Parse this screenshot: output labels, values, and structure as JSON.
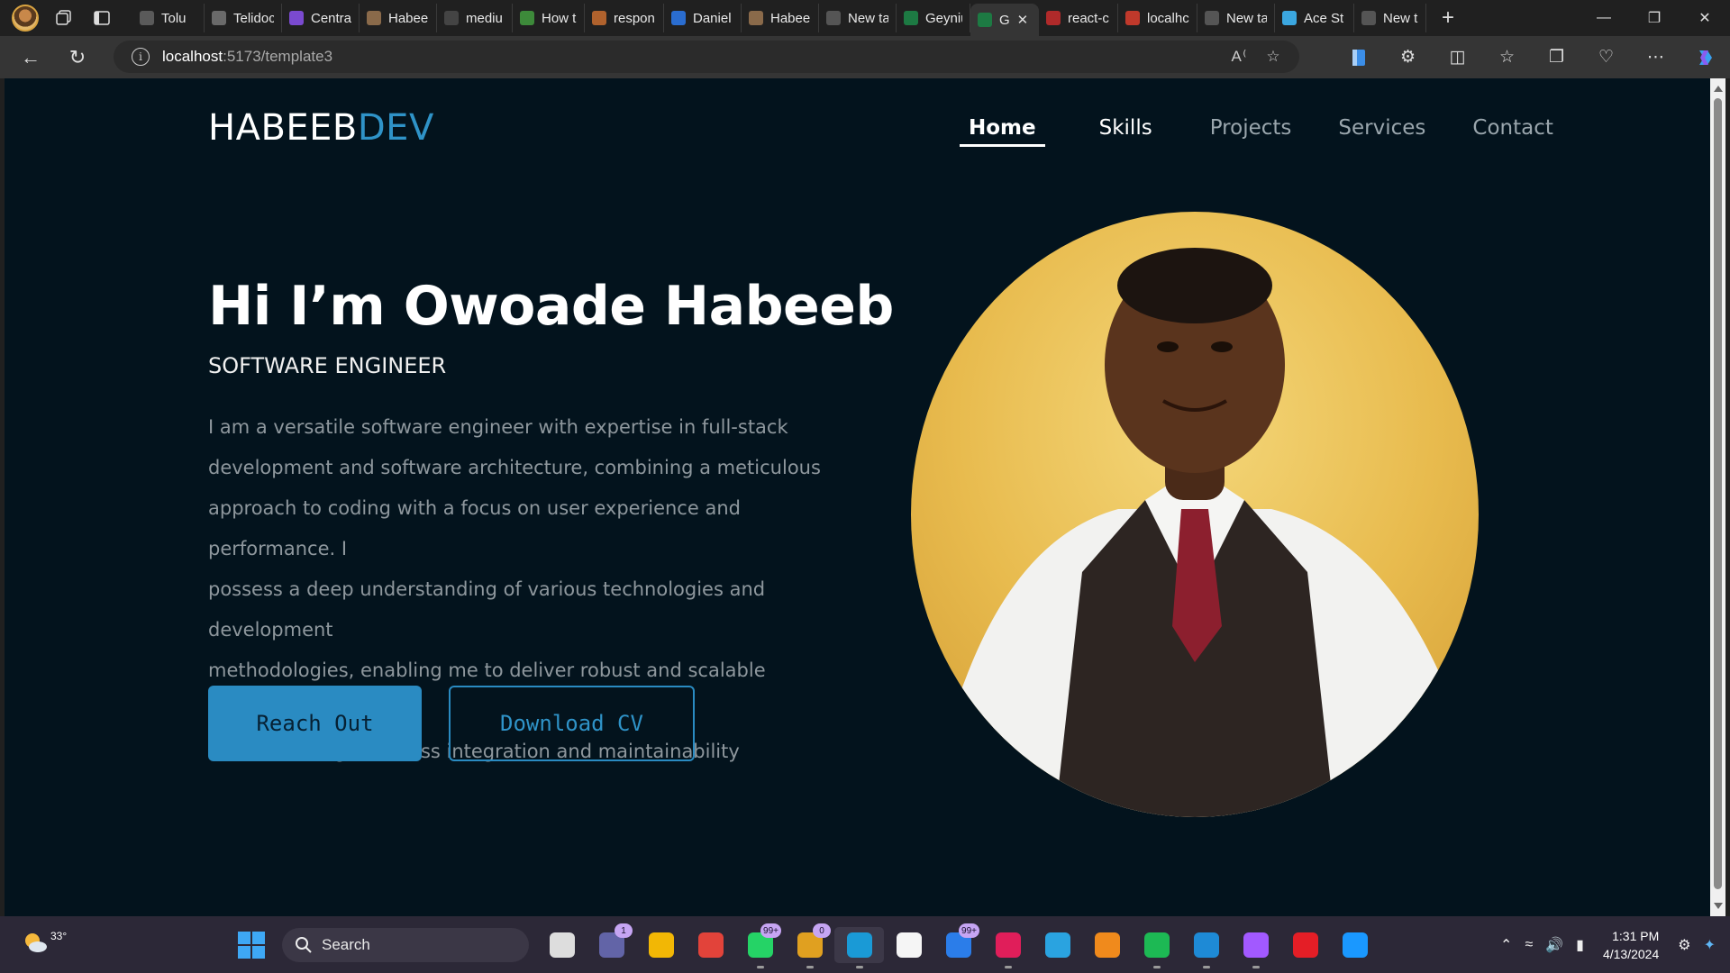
{
  "browser": {
    "tabs": [
      {
        "title": "Tolu",
        "color": "#5a5a5a"
      },
      {
        "title": "Telidoc",
        "color": "#6a6a6a"
      },
      {
        "title": "Centra",
        "color": "#7a4ad0"
      },
      {
        "title": "Habee",
        "color": "#8a6a4a"
      },
      {
        "title": "mediu",
        "color": "#444"
      },
      {
        "title": "How to",
        "color": "#3d8a3a"
      },
      {
        "title": "respon",
        "color": "#b0622d"
      },
      {
        "title": "Daniel",
        "color": "#2a6dd0"
      },
      {
        "title": "Habee",
        "color": "#8a6a4a"
      },
      {
        "title": "New ta",
        "color": "#555"
      },
      {
        "title": "Geyniu",
        "color": "#1d7a43"
      },
      {
        "title": "G",
        "color": "#1d7a43"
      },
      {
        "title": "react-c",
        "color": "#b02a2a"
      },
      {
        "title": "localhc",
        "color": "#c0392b"
      },
      {
        "title": "New ta",
        "color": "#555"
      },
      {
        "title": "Ace St",
        "color": "#3ba7e0"
      },
      {
        "title": "New ta",
        "color": "#555"
      }
    ],
    "active_tab_index": 11,
    "url_host": "localhost",
    "url_path": ":5173/template3"
  },
  "site": {
    "logo_main": "HABEEB",
    "logo_accent": "DEV",
    "nav": [
      "Home",
      "Skills",
      "Projects",
      "Services",
      "Contact"
    ],
    "active_nav": "Home",
    "hero": {
      "title": "Hi I’m Owoade Habeeb",
      "subtitle": "SOFTWARE ENGINEER",
      "description_lines": [
        "I am a versatile software engineer with expertise in full-stack",
        "development and software architecture, combining a meticulous",
        "approach to coding with a focus on user experience and performance. I",
        "possess a deep understanding of various technologies and development",
        "methodologies, enabling me to deliver robust and scalable solutions",
        "while ensuring seamless integration and maintainability"
      ],
      "primary_button": "Reach Out",
      "secondary_button": "Download CV"
    },
    "colors": {
      "background": "#03131d",
      "accent": "#2a8bc2"
    }
  },
  "taskbar": {
    "weather_temp": "33°",
    "search_label": "Search",
    "apps": [
      {
        "name": "file-manager",
        "color": "#ddd",
        "badge": ""
      },
      {
        "name": "teams",
        "color": "#6264a7",
        "badge": "1"
      },
      {
        "name": "file-explorer",
        "color": "#f2b705",
        "badge": ""
      },
      {
        "name": "camera",
        "color": "#e2433a",
        "badge": ""
      },
      {
        "name": "whatsapp",
        "color": "#25d366",
        "badge": "99+"
      },
      {
        "name": "chrome",
        "color": "#e0a020",
        "badge": "0"
      },
      {
        "name": "edge",
        "color": "#1a9ad6",
        "badge": ""
      },
      {
        "name": "store",
        "color": "#f5f5f5",
        "badge": ""
      },
      {
        "name": "mail",
        "color": "#2b7de9",
        "badge": "99+"
      },
      {
        "name": "slack",
        "color": "#e01e5a",
        "badge": ""
      },
      {
        "name": "telegram",
        "color": "#2aa3e0",
        "badge": ""
      },
      {
        "name": "vlc",
        "color": "#f08a1c",
        "badge": ""
      },
      {
        "name": "spotify",
        "color": "#1db954",
        "badge": ""
      },
      {
        "name": "vscode",
        "color": "#1e8ad6",
        "badge": ""
      },
      {
        "name": "figma",
        "color": "#a259ff",
        "badge": ""
      },
      {
        "name": "opera",
        "color": "#e41e26",
        "badge": ""
      },
      {
        "name": "prime-video",
        "color": "#1a98ff",
        "badge": ""
      }
    ],
    "time": "1:31 PM",
    "date": "4/13/2024"
  }
}
